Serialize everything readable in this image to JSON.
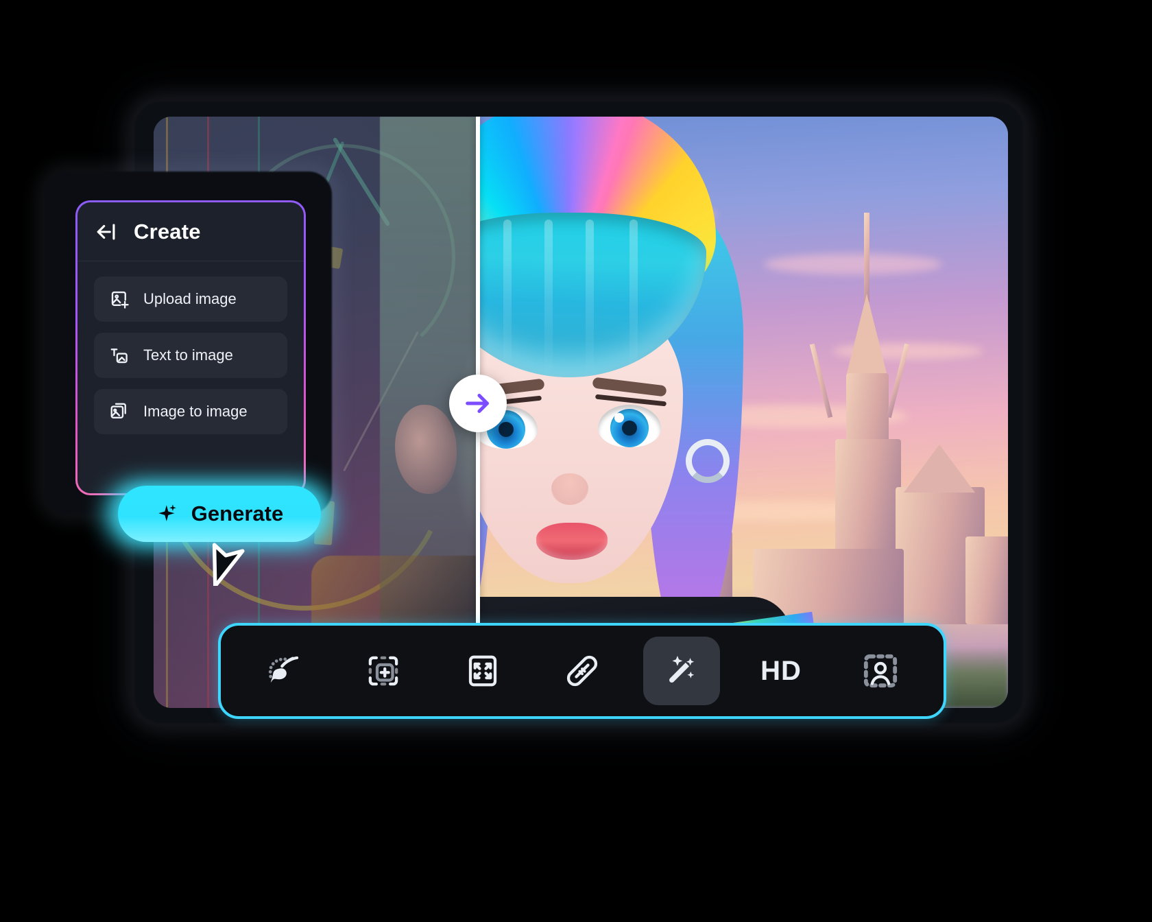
{
  "app": {
    "theme_accent_cyan": "#3ed6ff",
    "theme_accent_purple": "#7c4dff",
    "panel_border_gradient_from": "#8b5cf6",
    "panel_border_gradient_to": "#f472b6"
  },
  "create_panel": {
    "back_icon": "back-arrow-icon",
    "title": "Create",
    "options": [
      {
        "icon": "upload-image-icon",
        "label": "Upload image"
      },
      {
        "icon": "text-to-image-icon",
        "label": "Text to image"
      },
      {
        "icon": "image-to-image-icon",
        "label": "Image to image"
      }
    ]
  },
  "generate_button": {
    "icon": "sparkle-icon",
    "label": "Generate"
  },
  "comparison": {
    "handle_icon": "arrow-right-icon",
    "handle_color": "#7c4dff",
    "divider_position_pct": 38
  },
  "toolbar": {
    "items": [
      {
        "icon": "paint-brush-icon",
        "label": "",
        "active": false
      },
      {
        "icon": "add-object-icon",
        "label": "",
        "active": false
      },
      {
        "icon": "expand-frame-icon",
        "label": "",
        "active": false
      },
      {
        "icon": "bandage-heal-icon",
        "label": "",
        "active": false
      },
      {
        "icon": "magic-wand-icon",
        "label": "",
        "active": true
      },
      {
        "icon": "hd-text-icon",
        "label": "HD",
        "active": false
      },
      {
        "icon": "portrait-select-icon",
        "label": "",
        "active": false
      }
    ]
  },
  "cursor": {
    "icon": "mouse-pointer-icon"
  }
}
